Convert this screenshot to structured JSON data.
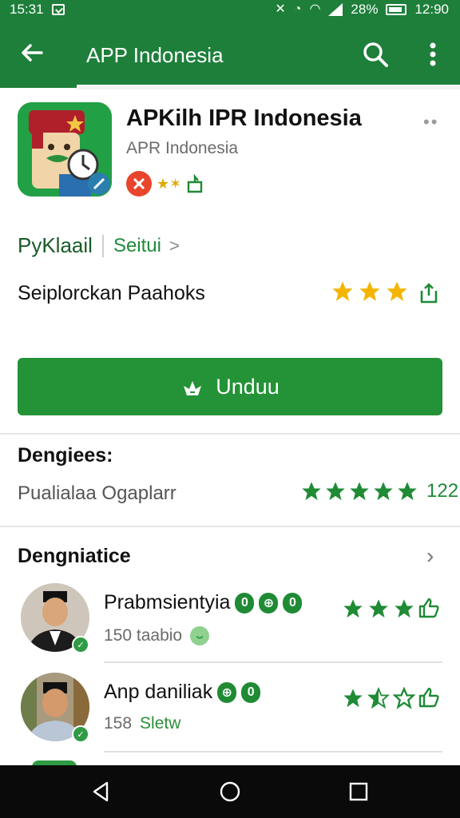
{
  "status_bar": {
    "time_left": "15:31",
    "battery": "28%",
    "time_right": "12:90"
  },
  "app_bar": {
    "title": "APP Indonesia"
  },
  "app": {
    "name": "APKilh IPR Indonesia",
    "developer": "APR Indonesia"
  },
  "category": {
    "label": "PyKlaail",
    "link": "Seitui",
    "chevron": ">"
  },
  "rating_line": {
    "label": "Seiplorckan Paahoks",
    "stars": 3
  },
  "install": {
    "label": "Unduu"
  },
  "ratings_section": {
    "title": "Dengiees:",
    "subtitle": "Pualialaa Ogaplarr",
    "stars": 5,
    "count": "122"
  },
  "reviews_section": {
    "title": "Dengniatice",
    "reviews": [
      {
        "name": "Prabmsientyia",
        "pills": [
          "0",
          "⊕",
          "0"
        ],
        "meta": "150 taabio",
        "meta_extra": "",
        "stars": 3
      },
      {
        "name": "Anp daniliak",
        "pills": [
          "⊕",
          "0"
        ],
        "meta": "158",
        "meta_extra": "Sletw",
        "stars": 2.5
      }
    ]
  },
  "colors": {
    "primary": "#1e7f3a",
    "button": "#249236",
    "star_yellow": "#f4b400",
    "star_green": "#1f8b35"
  },
  "icons": {
    "back": "arrow-left-icon",
    "search": "search-icon",
    "more": "more-vert-icon",
    "install": "download-icon",
    "share": "share-icon",
    "thumb": "thumbs-up-icon"
  }
}
